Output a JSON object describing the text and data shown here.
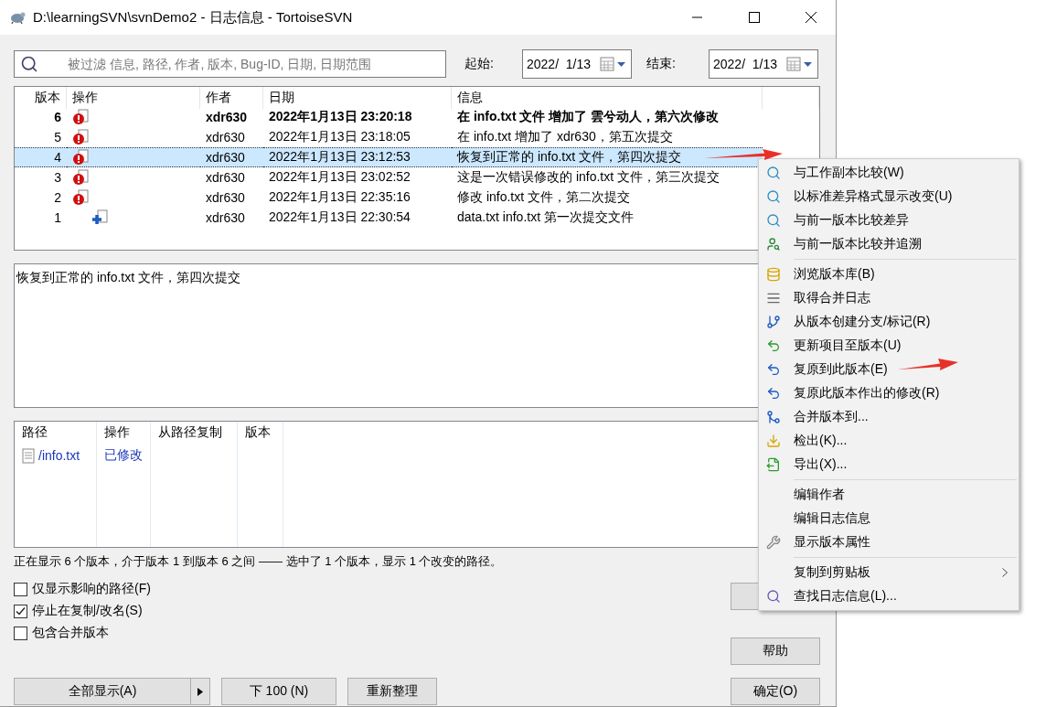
{
  "window": {
    "title": "D:\\learningSVN\\svnDemo2 - 日志信息 - TortoiseSVN"
  },
  "filter": {
    "placeholder": "被过滤 信息, 路径, 作者, 版本, Bug-ID, 日期, 日期范围"
  },
  "date_from": {
    "label": "起始:",
    "value": "2022/  1/13"
  },
  "date_to": {
    "label": "结束:",
    "value": "2022/  1/13"
  },
  "log": {
    "columns": [
      "版本",
      "操作",
      "作者",
      "日期",
      "信息"
    ],
    "rows": [
      {
        "revision": "6",
        "kind": "modified",
        "author": "xdr630",
        "date": "2022年1月13日 23:20:18",
        "message": "在 info.txt 文件 增加了 雲兮动人，第六次修改",
        "bold": true,
        "selected": false
      },
      {
        "revision": "5",
        "kind": "modified",
        "author": "xdr630",
        "date": "2022年1月13日 23:18:05",
        "message": "在 info.txt 增加了 xdr630，第五次提交",
        "bold": false,
        "selected": false
      },
      {
        "revision": "4",
        "kind": "modified",
        "author": "xdr630",
        "date": "2022年1月13日 23:12:53",
        "message": "恢复到正常的 info.txt 文件，第四次提交",
        "bold": false,
        "selected": true
      },
      {
        "revision": "3",
        "kind": "modified",
        "author": "xdr630",
        "date": "2022年1月13日 23:02:52",
        "message": "这是一次错误修改的 info.txt 文件，第三次提交",
        "bold": false,
        "selected": false
      },
      {
        "revision": "2",
        "kind": "modified",
        "author": "xdr630",
        "date": "2022年1月13日 22:35:16",
        "message": "修改 info.txt 文件，第二次提交",
        "bold": false,
        "selected": false
      },
      {
        "revision": "1",
        "kind": "added",
        "author": "xdr630",
        "date": "2022年1月13日 22:30:54",
        "message": "data.txt info.txt 第一次提交文件",
        "bold": false,
        "selected": false
      }
    ]
  },
  "message_box": {
    "value": "恢复到正常的 info.txt 文件，第四次提交"
  },
  "changed_paths": {
    "columns": [
      "路径",
      "操作",
      "从路径复制",
      "版本"
    ],
    "rows": [
      {
        "path": "/info.txt",
        "action": "已修改"
      }
    ]
  },
  "status": "正在显示 6 个版本，介于版本 1 到版本 6 之间 —— 选中了 1 个版本，显示 1 个改变的路径。",
  "options": [
    {
      "label": "仅显示影响的路径(F)",
      "checked": false
    },
    {
      "label": "停止在复制/改名(S)",
      "checked": true
    },
    {
      "label": "包含合并版本",
      "checked": false
    }
  ],
  "buttons": {
    "help": "帮助",
    "show_all": "全部显示(A)",
    "next": "下 100 (N)",
    "refresh": "重新整理",
    "ok": "确定(O)"
  },
  "context_menu": [
    {
      "kind": "item",
      "label": "与工作副本比较(W)"
    },
    {
      "kind": "item",
      "label": "以标准差异格式显示改变(U)"
    },
    {
      "kind": "item",
      "label": "与前一版本比较差异"
    },
    {
      "kind": "item",
      "label": "与前一版本比较并追溯"
    },
    {
      "kind": "separator"
    },
    {
      "kind": "item",
      "label": "浏览版本库(B)"
    },
    {
      "kind": "item",
      "label": "取得合并日志"
    },
    {
      "kind": "item",
      "label": "从版本创建分支/标记(R)"
    },
    {
      "kind": "item",
      "label": "更新项目至版本(U)"
    },
    {
      "kind": "item",
      "label": "复原到此版本(E)"
    },
    {
      "kind": "item",
      "label": "复原此版本作出的修改(R)"
    },
    {
      "kind": "item",
      "label": "合并版本到..."
    },
    {
      "kind": "item",
      "label": "检出(K)..."
    },
    {
      "kind": "item",
      "label": "导出(X)..."
    },
    {
      "kind": "separator"
    },
    {
      "kind": "item",
      "label": "编辑作者"
    },
    {
      "kind": "item",
      "label": "编辑日志信息"
    },
    {
      "kind": "item",
      "label": "显示版本属性"
    },
    {
      "kind": "separator"
    },
    {
      "kind": "submenu",
      "label": "复制到剪贴板"
    },
    {
      "kind": "item",
      "label": "查找日志信息(L)..."
    }
  ]
}
